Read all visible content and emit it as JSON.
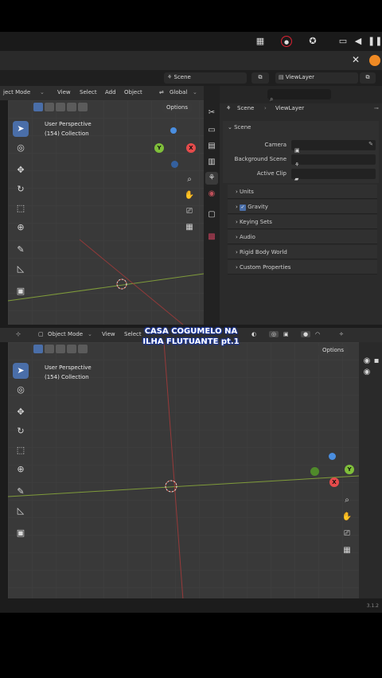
{
  "tray": {
    "icons": [
      "layers-icon",
      "record-icon",
      "accessibility-icon",
      "cast-icon",
      "volume-icon",
      "pause-icon"
    ]
  },
  "scene_bar": {
    "scene": "Scene",
    "view_layer": "ViewLayer"
  },
  "top_viewport": {
    "mode_label": "ject Mode",
    "menus": [
      "View",
      "Select",
      "Add",
      "Object"
    ],
    "transform": "Global",
    "options": "Options",
    "perspective": "User Perspective",
    "collection": "(154) Collection"
  },
  "properties": {
    "breadcrumb_scene": "Scene",
    "breadcrumb_layer": "ViewLayer",
    "section_scene": "Scene",
    "camera_label": "Camera",
    "background_label": "Background Scene",
    "clip_label": "Active Clip",
    "panels": [
      "Units",
      "Gravity",
      "Keying Sets",
      "Audio",
      "Rigid Body World",
      "Custom Properties"
    ],
    "gravity_checked": true
  },
  "bottom_viewport": {
    "mode_label": "Object Mode",
    "menus": [
      "View",
      "Select"
    ],
    "options": "Options",
    "perspective": "User Perspective",
    "collection": "(154) Collection"
  },
  "caption": {
    "line1": "CASA COGUMELO NA",
    "line2": "ILHA FLUTUANTE pt.1"
  },
  "status": {
    "version": "3.1.2"
  },
  "colors": {
    "accent": "#4a6ea8",
    "x_axis": "#e64b4b",
    "y_axis": "#7fbf3a",
    "z_axis": "#4a8ee0",
    "orange": "#f08a24"
  }
}
